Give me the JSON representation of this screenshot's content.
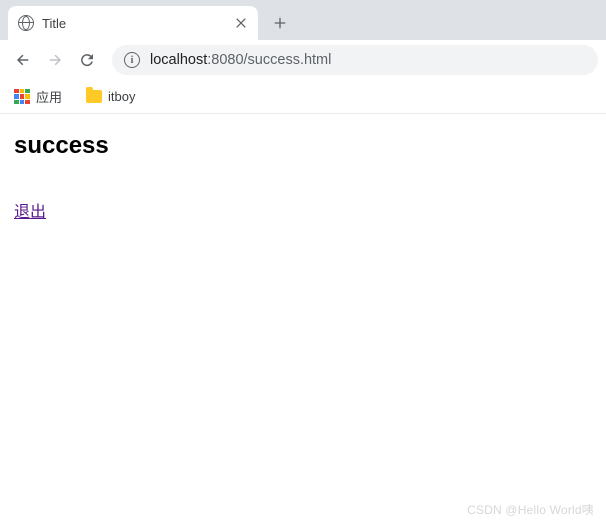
{
  "tab": {
    "title": "Title"
  },
  "url": {
    "host": "localhost",
    "port": ":8080",
    "path": "/success.html"
  },
  "bookmarks": {
    "apps_label": "应用",
    "items": [
      {
        "label": "itboy"
      }
    ]
  },
  "page": {
    "heading": "success",
    "logout_link": "退出"
  },
  "watermark": "CSDN @Hello World咦"
}
